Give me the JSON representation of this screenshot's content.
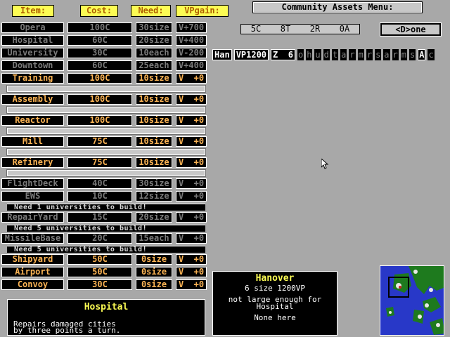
{
  "headers": {
    "item": "Item:",
    "cost": "Cost:",
    "need": "Need:",
    "vpgain": "VPgain:"
  },
  "rows": [
    {
      "name": "Opera",
      "cost": "100C",
      "need": "30size",
      "vp": "V+700",
      "enabled": false
    },
    {
      "name": "Hospital",
      "cost": "60C",
      "need": "20size",
      "vp": "V+400",
      "enabled": false
    },
    {
      "name": "University",
      "cost": "30C",
      "need": "10each",
      "vp": "V-200",
      "enabled": false
    },
    {
      "name": "Downtown",
      "cost": "60C",
      "need": "25each",
      "vp": "V+400",
      "enabled": false
    },
    {
      "name": "Training",
      "cost": "100C",
      "need": "10size",
      "vp": "V  +0",
      "enabled": true
    },
    {
      "name": "Assembly",
      "cost": "100C",
      "need": "10size",
      "vp": "V  +0",
      "enabled": true
    },
    {
      "name": "Reactor",
      "cost": "100C",
      "need": "10size",
      "vp": "V  +0",
      "enabled": true
    },
    {
      "name": "Mill",
      "cost": "75C",
      "need": "10size",
      "vp": "V  +0",
      "enabled": true
    },
    {
      "name": "Refinery",
      "cost": "75C",
      "need": "10size",
      "vp": "V  +0",
      "enabled": true
    },
    {
      "name": "FlightDeck",
      "cost": "40C",
      "need": "30size",
      "vp": "V  +0",
      "enabled": false
    },
    {
      "name": "EWS",
      "cost": "10C",
      "need": "12size",
      "vp": "V  +0",
      "enabled": false
    },
    {
      "name": "RepairYard",
      "cost": "15C",
      "need": "20size",
      "vp": "V  +0",
      "enabled": false
    },
    {
      "name": "MissileBase",
      "cost": "20C",
      "need": "15each",
      "vp": "V  +0",
      "enabled": false
    },
    {
      "name": "Shipyard",
      "cost": "50C",
      "need": "0size",
      "vp": "V  +0",
      "enabled": true
    },
    {
      "name": "Airport",
      "cost": "50C",
      "need": "0size",
      "vp": "V  +0",
      "enabled": true
    },
    {
      "name": "Convoy",
      "cost": "30C",
      "need": "0size",
      "vp": "V  +0",
      "enabled": true
    }
  ],
  "notes": {
    "ews": "Need  1 universities to build!",
    "repairyard": "Need  5 universities to build!",
    "missilebase": "Need  5 universities to build!"
  },
  "menu_title": "Community Assets Menu:",
  "resources": [
    "5C",
    "8T",
    "2R",
    "0A"
  ],
  "done_label": "<D>one",
  "city_row": [
    "Han",
    "VP1200",
    "Z  6",
    "o",
    "h",
    "u",
    "d",
    "t",
    "a",
    "r",
    "m",
    "r",
    "s",
    "a",
    "r",
    "m",
    "s",
    "A",
    "c"
  ],
  "description": {
    "title": "Hospital",
    "line1": "Repairs damaged cities",
    "line2": "by three points a turn."
  },
  "city_info": {
    "name": "Hanover",
    "stats": "6 size 1200VP",
    "msg1": "not large enough for",
    "msg2": "Hospital",
    "here": "None here"
  },
  "colors": {
    "header_bg": "#fcfc54",
    "enabled_text": "#fcb454",
    "disabled_text": "#7a7a7a",
    "background": "#a8a8a8",
    "map_sea": "#2838c8"
  }
}
